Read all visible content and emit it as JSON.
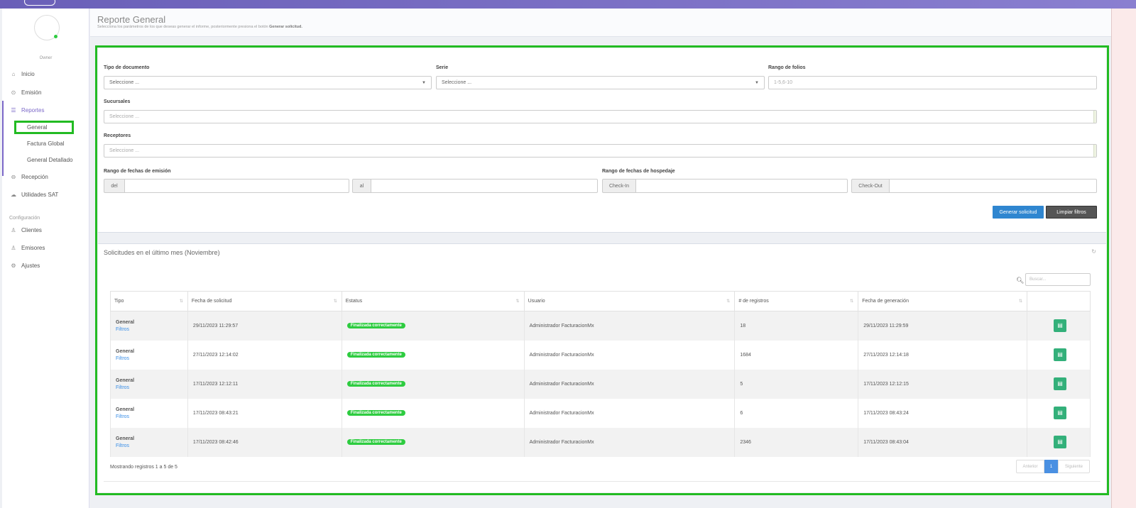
{
  "sidebar": {
    "role": "Owner",
    "items": [
      {
        "label": "Inicio",
        "icon": "home-icon"
      },
      {
        "label": "Emisión",
        "icon": "circle-arrow-icon"
      },
      {
        "label": "Reportes",
        "icon": "list-icon"
      },
      {
        "label": "Recepción",
        "icon": "circle-arrow-left-icon"
      },
      {
        "label": "Utilidades SAT",
        "icon": "cloud-icon"
      }
    ],
    "reports_sub": [
      "General",
      "Factura Global",
      "General Detallado"
    ],
    "config_label": "Configuración",
    "config_items": [
      {
        "label": "Clientes",
        "icon": "users-icon"
      },
      {
        "label": "Emisores",
        "icon": "user-icon"
      },
      {
        "label": "Ajustes",
        "icon": "gear-icon"
      }
    ],
    "accent": "#7b68c8"
  },
  "header": {
    "title": "Reporte General",
    "subtitle": "Selecciona los parámetros de los que deseas generar el informe, posteriormente presiona el botón",
    "subtitle_bold": "Generar solicitud."
  },
  "filters": {
    "tipo_label": "Tipo de documento",
    "tipo_value": "Seleccione ...",
    "serie_label": "Serie",
    "serie_value": "Seleccione ...",
    "folios_label": "Rango de folios",
    "folios_placeholder": "1-5,6-10",
    "sucursales_label": "Sucursales",
    "sucursales_placeholder": "Seleccione ...",
    "receptores_label": "Receptores",
    "receptores_placeholder": "Seleccione ...",
    "emision_label": "Rango de fechas de emisión",
    "del_label": "del",
    "al_label": "al",
    "hospedaje_label": "Rango de fechas de hospedaje",
    "checkin_label": "Check-In",
    "checkout_label": "Check-Out",
    "generate_button": "Generar solicitud",
    "clear_button": "Limpiar filtros"
  },
  "results": {
    "title": "Solicitudes en el último mes (Noviembre)",
    "search_placeholder": "Buscar...",
    "columns": [
      "Tipo",
      "Fecha de solicitud",
      "Estatus",
      "Usuario",
      "# de registros",
      "Fecha de generación"
    ],
    "rows": [
      {
        "tipo": "General",
        "link": "Filtros",
        "fecha": "29/11/2023 11:29:57",
        "estatus": "Finalizada correctamente",
        "usuario": "Administrador FacturacionMx",
        "registros": "18",
        "generacion": "29/11/2023 11:29:59"
      },
      {
        "tipo": "General",
        "link": "Filtros",
        "fecha": "27/11/2023 12:14:02",
        "estatus": "Finalizada correctamente",
        "usuario": "Administrador FacturacionMx",
        "registros": "1684",
        "generacion": "27/11/2023 12:14:18"
      },
      {
        "tipo": "General",
        "link": "Filtros",
        "fecha": "17/11/2023 12:12:11",
        "estatus": "Finalizada correctamente",
        "usuario": "Administrador FacturacionMx",
        "registros": "5",
        "generacion": "17/11/2023 12:12:15"
      },
      {
        "tipo": "General",
        "link": "Filtros",
        "fecha": "17/11/2023 08:43:21",
        "estatus": "Finalizada correctamente",
        "usuario": "Administrador FacturacionMx",
        "registros": "6",
        "generacion": "17/11/2023 08:43:24"
      },
      {
        "tipo": "General",
        "link": "Filtros",
        "fecha": "17/11/2023 08:42:46",
        "estatus": "Finalizada correctamente",
        "usuario": "Administrador FacturacionMx",
        "registros": "2346",
        "generacion": "17/11/2023 08:43:04"
      }
    ],
    "showing": "Mostrando registros 1 a 5 de 5",
    "pager": {
      "prev": "Anterior",
      "current": "1",
      "next": "Siguiente"
    },
    "status_color": "#2ecc40",
    "download_color": "#33b07a"
  }
}
